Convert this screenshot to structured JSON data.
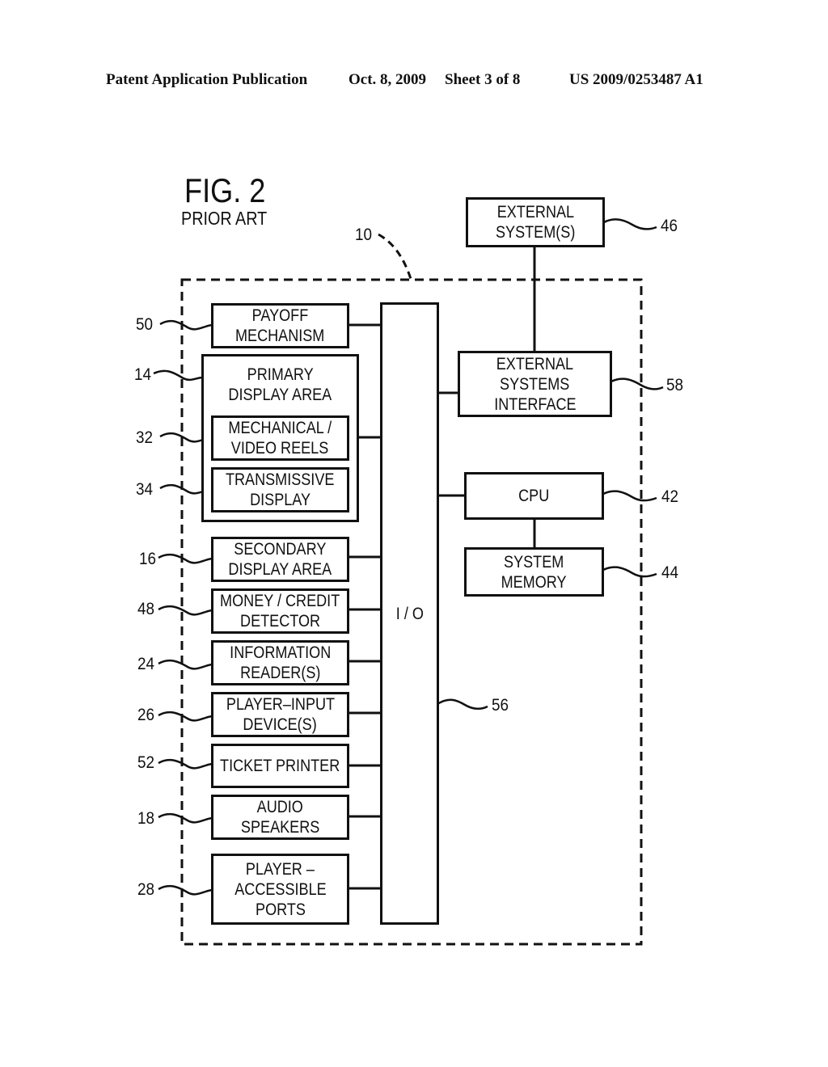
{
  "header": {
    "publication": "Patent Application Publication",
    "date": "Oct. 8, 2009",
    "sheet": "Sheet 3 of 8",
    "number": "US 2009/0253487 A1"
  },
  "figure": {
    "title": "FIG. 2",
    "subtitle": "PRIOR ART",
    "system_ref": "10"
  },
  "components": {
    "payoff": {
      "line1": "PAYOFF",
      "line2": "MECHANISM",
      "ref": "50"
    },
    "primary_display": {
      "line1": "PRIMARY",
      "line2": "DISPLAY AREA",
      "ref": "14"
    },
    "reels": {
      "line1": "MECHANICAL /",
      "line2": "VIDEO  REELS",
      "ref": "32"
    },
    "transmissive": {
      "line1": "TRANSMISSIVE",
      "line2": "DISPLAY",
      "ref": "34"
    },
    "secondary_display": {
      "line1": "SECONDARY",
      "line2": "DISPLAY AREA",
      "ref": "16"
    },
    "money": {
      "line1": "MONEY / CREDIT",
      "line2": "DETECTOR",
      "ref": "48"
    },
    "info_reader": {
      "line1": "INFORMATION",
      "line2": "READER(S)",
      "ref": "24"
    },
    "player_input": {
      "line1": "PLAYER–INPUT",
      "line2": "DEVICE(S)",
      "ref": "26"
    },
    "ticket_printer": {
      "line1": "TICKET  PRINTER",
      "ref": "52"
    },
    "audio": {
      "line1": "AUDIO",
      "line2": "SPEAKERS",
      "ref": "18"
    },
    "ports": {
      "line1": "PLAYER  –",
      "line2": "ACCESSIBLE",
      "line3": "PORTS",
      "ref": "28"
    },
    "io": {
      "label": "I / O",
      "ref": "56"
    },
    "external_systems": {
      "line1": "EXTERNAL",
      "line2": "SYSTEM(S)",
      "ref": "46"
    },
    "ext_interface": {
      "line1": "EXTERNAL",
      "line2": "SYSTEMS",
      "line3": "INTERFACE",
      "ref": "58"
    },
    "cpu": {
      "label": "CPU",
      "ref": "42"
    },
    "memory": {
      "line1": "SYSTEM",
      "line2": "MEMORY",
      "ref": "44"
    }
  }
}
